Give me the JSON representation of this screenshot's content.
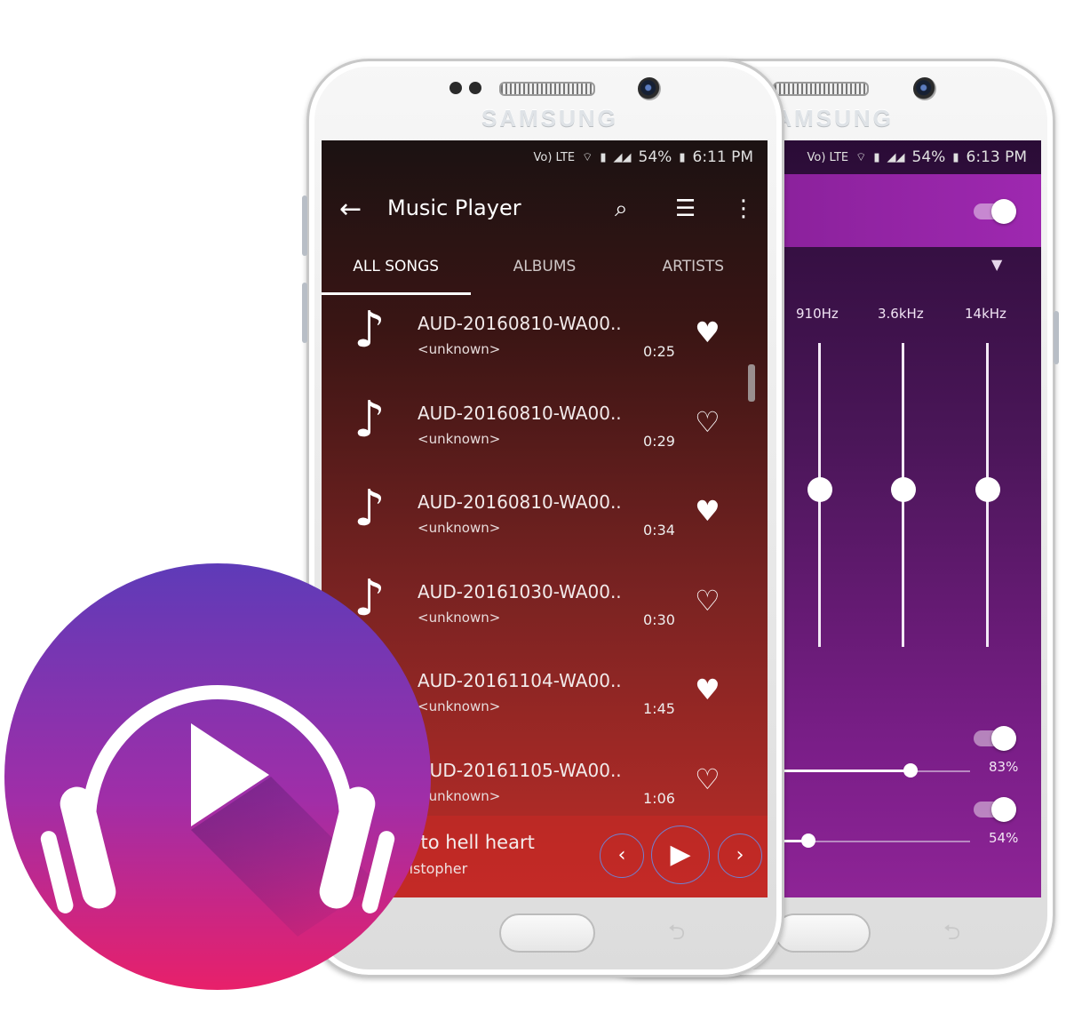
{
  "device_brand": "SAMSUNG",
  "status_front": {
    "battery": "54%",
    "time": "6:11 PM"
  },
  "status_back": {
    "battery": "54%",
    "time": "6:13 PM"
  },
  "app": {
    "title": "Music Player",
    "tabs": [
      "ALL SONGS",
      "ALBUMS",
      "ARTISTS"
    ],
    "icons": [
      "back-arrow-icon",
      "search-icon",
      "sort-icon",
      "more-vert-icon"
    ]
  },
  "songs": [
    {
      "title": "AUD-20160810-WA00..",
      "artist": "<unknown>",
      "duration": "0:25",
      "favorite": true
    },
    {
      "title": "AUD-20160810-WA00..",
      "artist": "<unknown>",
      "duration": "0:29",
      "favorite": false
    },
    {
      "title": "AUD-20160810-WA00..",
      "artist": "<unknown>",
      "duration": "0:34",
      "favorite": true
    },
    {
      "title": "AUD-20161030-WA00..",
      "artist": "<unknown>",
      "duration": "0:30",
      "favorite": false
    },
    {
      "title": "AUD-20161104-WA00..",
      "artist": "<unknown>",
      "duration": "1:45",
      "favorite": true
    },
    {
      "title": "AUD-20161105-WA00..",
      "artist": "<unknown>",
      "duration": "1:06",
      "favorite": false
    }
  ],
  "now_playing": {
    "title": "o to hell heart",
    "artist": "ristopher"
  },
  "equalizer": {
    "bands": [
      {
        "label": "910Hz",
        "level": 0.5
      },
      {
        "label": "3.6kHz",
        "level": 0.5
      },
      {
        "label": "14kHz",
        "level": 0.5
      }
    ],
    "bass_boost": {
      "value": "83%",
      "fraction": 0.83
    },
    "virtualizer": {
      "value": "54%",
      "fraction": 0.54
    }
  },
  "colors": {
    "front_gradient_top": "#1b1212",
    "front_gradient_bottom": "#bf2d28",
    "back_gradient": "#7a1e88",
    "logo_top": "#5e3bb8",
    "logo_bottom": "#e8206a"
  }
}
